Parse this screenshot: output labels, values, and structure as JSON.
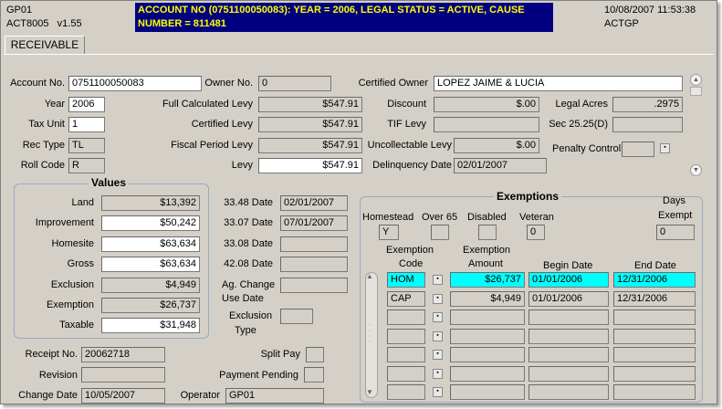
{
  "header": {
    "screen_id": "GP01",
    "program": "ACT8005",
    "version": "v1.55",
    "info_line": "ACCOUNT NO (0751100050083): YEAR = 2006, LEGAL STATUS = ACTIVE, CAUSE NUMBER = 811481",
    "datetime": "10/08/2007 11:53:38",
    "user": "ACTGP"
  },
  "tab": {
    "label": "RECEIVABLE"
  },
  "account": {
    "account_no_label": "Account No.",
    "account_no": "0751100050083",
    "owner_no_label": "Owner No.",
    "owner_no": "0",
    "certified_owner_label": "Certified Owner",
    "certified_owner": "LOPEZ JAIME & LUCIA",
    "year_label": "Year",
    "year": "2006",
    "tax_unit_label": "Tax Unit",
    "tax_unit": "1",
    "rec_type_label": "Rec Type",
    "rec_type": "TL",
    "roll_code_label": "Roll Code",
    "roll_code": "R"
  },
  "levy": {
    "full_calc_label": "Full Calculated Levy",
    "full_calc": "$547.91",
    "certified_label": "Certified Levy",
    "certified": "$547.91",
    "fiscal_label": "Fiscal Period Levy",
    "fiscal": "$547.91",
    "levy_label": "Levy",
    "levy": "$547.91"
  },
  "right": {
    "discount_label": "Discount",
    "discount": "$.00",
    "legal_acres_label": "Legal Acres",
    "legal_acres": ".2975",
    "tif_label": "TIF Levy",
    "tif": "",
    "sec_label": "Sec 25.25(D)",
    "sec": "",
    "uncollectable_label": "Uncollectable Levy",
    "uncollectable": "$.00",
    "penalty_label": "Penalty Control",
    "penalty": "",
    "delinquency_label": "Delinquency Date",
    "delinquency": "02/01/2007"
  },
  "values": {
    "title": "Values",
    "land_label": "Land",
    "land": "$13,392",
    "improvement_label": "Improvement",
    "improvement": "$50,242",
    "homesite_label": "Homesite",
    "homesite": "$63,634",
    "gross_label": "Gross",
    "gross": "$63,634",
    "exclusion_label": "Exclusion",
    "exclusion": "$4,949",
    "exemption_label": "Exemption",
    "exemption": "$26,737",
    "taxable_label": "Taxable",
    "taxable": "$31,948"
  },
  "dates": {
    "d3348_label": "33.48 Date",
    "d3348": "02/01/2007",
    "d3307_label": "33.07 Date",
    "d3307": "07/01/2007",
    "d3308_label": "33.08 Date",
    "d3308": "",
    "d4208_label": "42.08 Date",
    "d4208": "",
    "ag_label1": "Ag. Change",
    "ag_label2": "Use Date",
    "ag": "",
    "excl_type_label1": "Exclusion",
    "excl_type_label2": "Type",
    "excl_type": ""
  },
  "bottom": {
    "receipt_label": "Receipt No.",
    "receipt": "20062718",
    "revision_label": "Revision",
    "revision": "",
    "change_date_label": "Change Date",
    "change_date": "10/05/2007",
    "split_pay_label": "Split Pay",
    "split_pay": "",
    "payment_pending_label": "Payment Pending",
    "payment_pending": "",
    "operator_label": "Operator",
    "operator": "GP01"
  },
  "exemptions": {
    "title": "Exemptions",
    "days_exempt_label1": "Days",
    "days_exempt_label2": "Exempt",
    "days_exempt": "0",
    "homestead_label": "Homestead",
    "homestead": "Y",
    "over65_label": "Over 65",
    "over65": "",
    "disabled_label": "Disabled",
    "disabled": "",
    "veteran_label": "Veteran",
    "veteran": "0",
    "col_code1": "Exemption",
    "col_code2": "Code",
    "col_amount1": "Exemption",
    "col_amount2": "Amount",
    "col_begin": "Begin Date",
    "col_end": "End Date",
    "rows": [
      {
        "code": "HOM",
        "amount": "$26,737",
        "begin": "01/01/2006",
        "end": "12/31/2006"
      },
      {
        "code": "CAP",
        "amount": "$4,949",
        "begin": "01/01/2006",
        "end": "12/31/2006"
      },
      {
        "code": "",
        "amount": "",
        "begin": "",
        "end": ""
      },
      {
        "code": "",
        "amount": "",
        "begin": "",
        "end": ""
      },
      {
        "code": "",
        "amount": "",
        "begin": "",
        "end": ""
      },
      {
        "code": "",
        "amount": "",
        "begin": "",
        "end": ""
      },
      {
        "code": "",
        "amount": "",
        "begin": "",
        "end": ""
      }
    ]
  },
  "colors": {
    "header_bg": "#000080",
    "header_text": "#ffff00",
    "highlight": "#00ffff",
    "window_bg": "#d4d0c8"
  }
}
